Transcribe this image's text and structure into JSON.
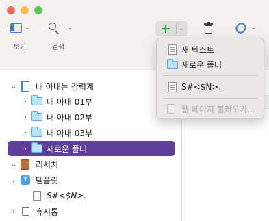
{
  "toolbar": {
    "view_label": "보기",
    "search_label": "검색"
  },
  "add_menu": {
    "items": [
      {
        "label": "새 텍스트",
        "enabled": true
      },
      {
        "label": "새로운 폴더",
        "enabled": true
      },
      {
        "label": "S#<$N>.",
        "enabled": true
      },
      {
        "label": "웹 페이지 불러오기...",
        "enabled": false
      }
    ]
  },
  "binder": {
    "items": [
      {
        "label": "내 아내는 강력계",
        "indent": 0,
        "expanded": true,
        "icon": "notebook-icon"
      },
      {
        "label": "내 아내 01부",
        "indent": 1,
        "expanded": false,
        "icon": "folder-icon"
      },
      {
        "label": "내 아내 02부",
        "indent": 1,
        "expanded": false,
        "icon": "folder-icon"
      },
      {
        "label": "내 아내 03부",
        "indent": 1,
        "expanded": false,
        "icon": "folder-icon"
      },
      {
        "label": "새로운 폴더",
        "indent": 1,
        "expanded": false,
        "icon": "folder-icon",
        "selected": true
      },
      {
        "label": "리서치",
        "indent": 0,
        "expanded": true,
        "icon": "research-icon"
      },
      {
        "label": "템플릿",
        "indent": 0,
        "expanded": true,
        "icon": "template-icon"
      },
      {
        "label": "S#<$N>.",
        "indent": 1,
        "icon": "document-icon"
      },
      {
        "label": "휴지통",
        "indent": 0,
        "expanded": false,
        "icon": "trash-icon"
      }
    ]
  },
  "colors": {
    "selection": "#5e3e99",
    "add_green": "#2ea04a",
    "folder_blue": "#59a9e8"
  }
}
